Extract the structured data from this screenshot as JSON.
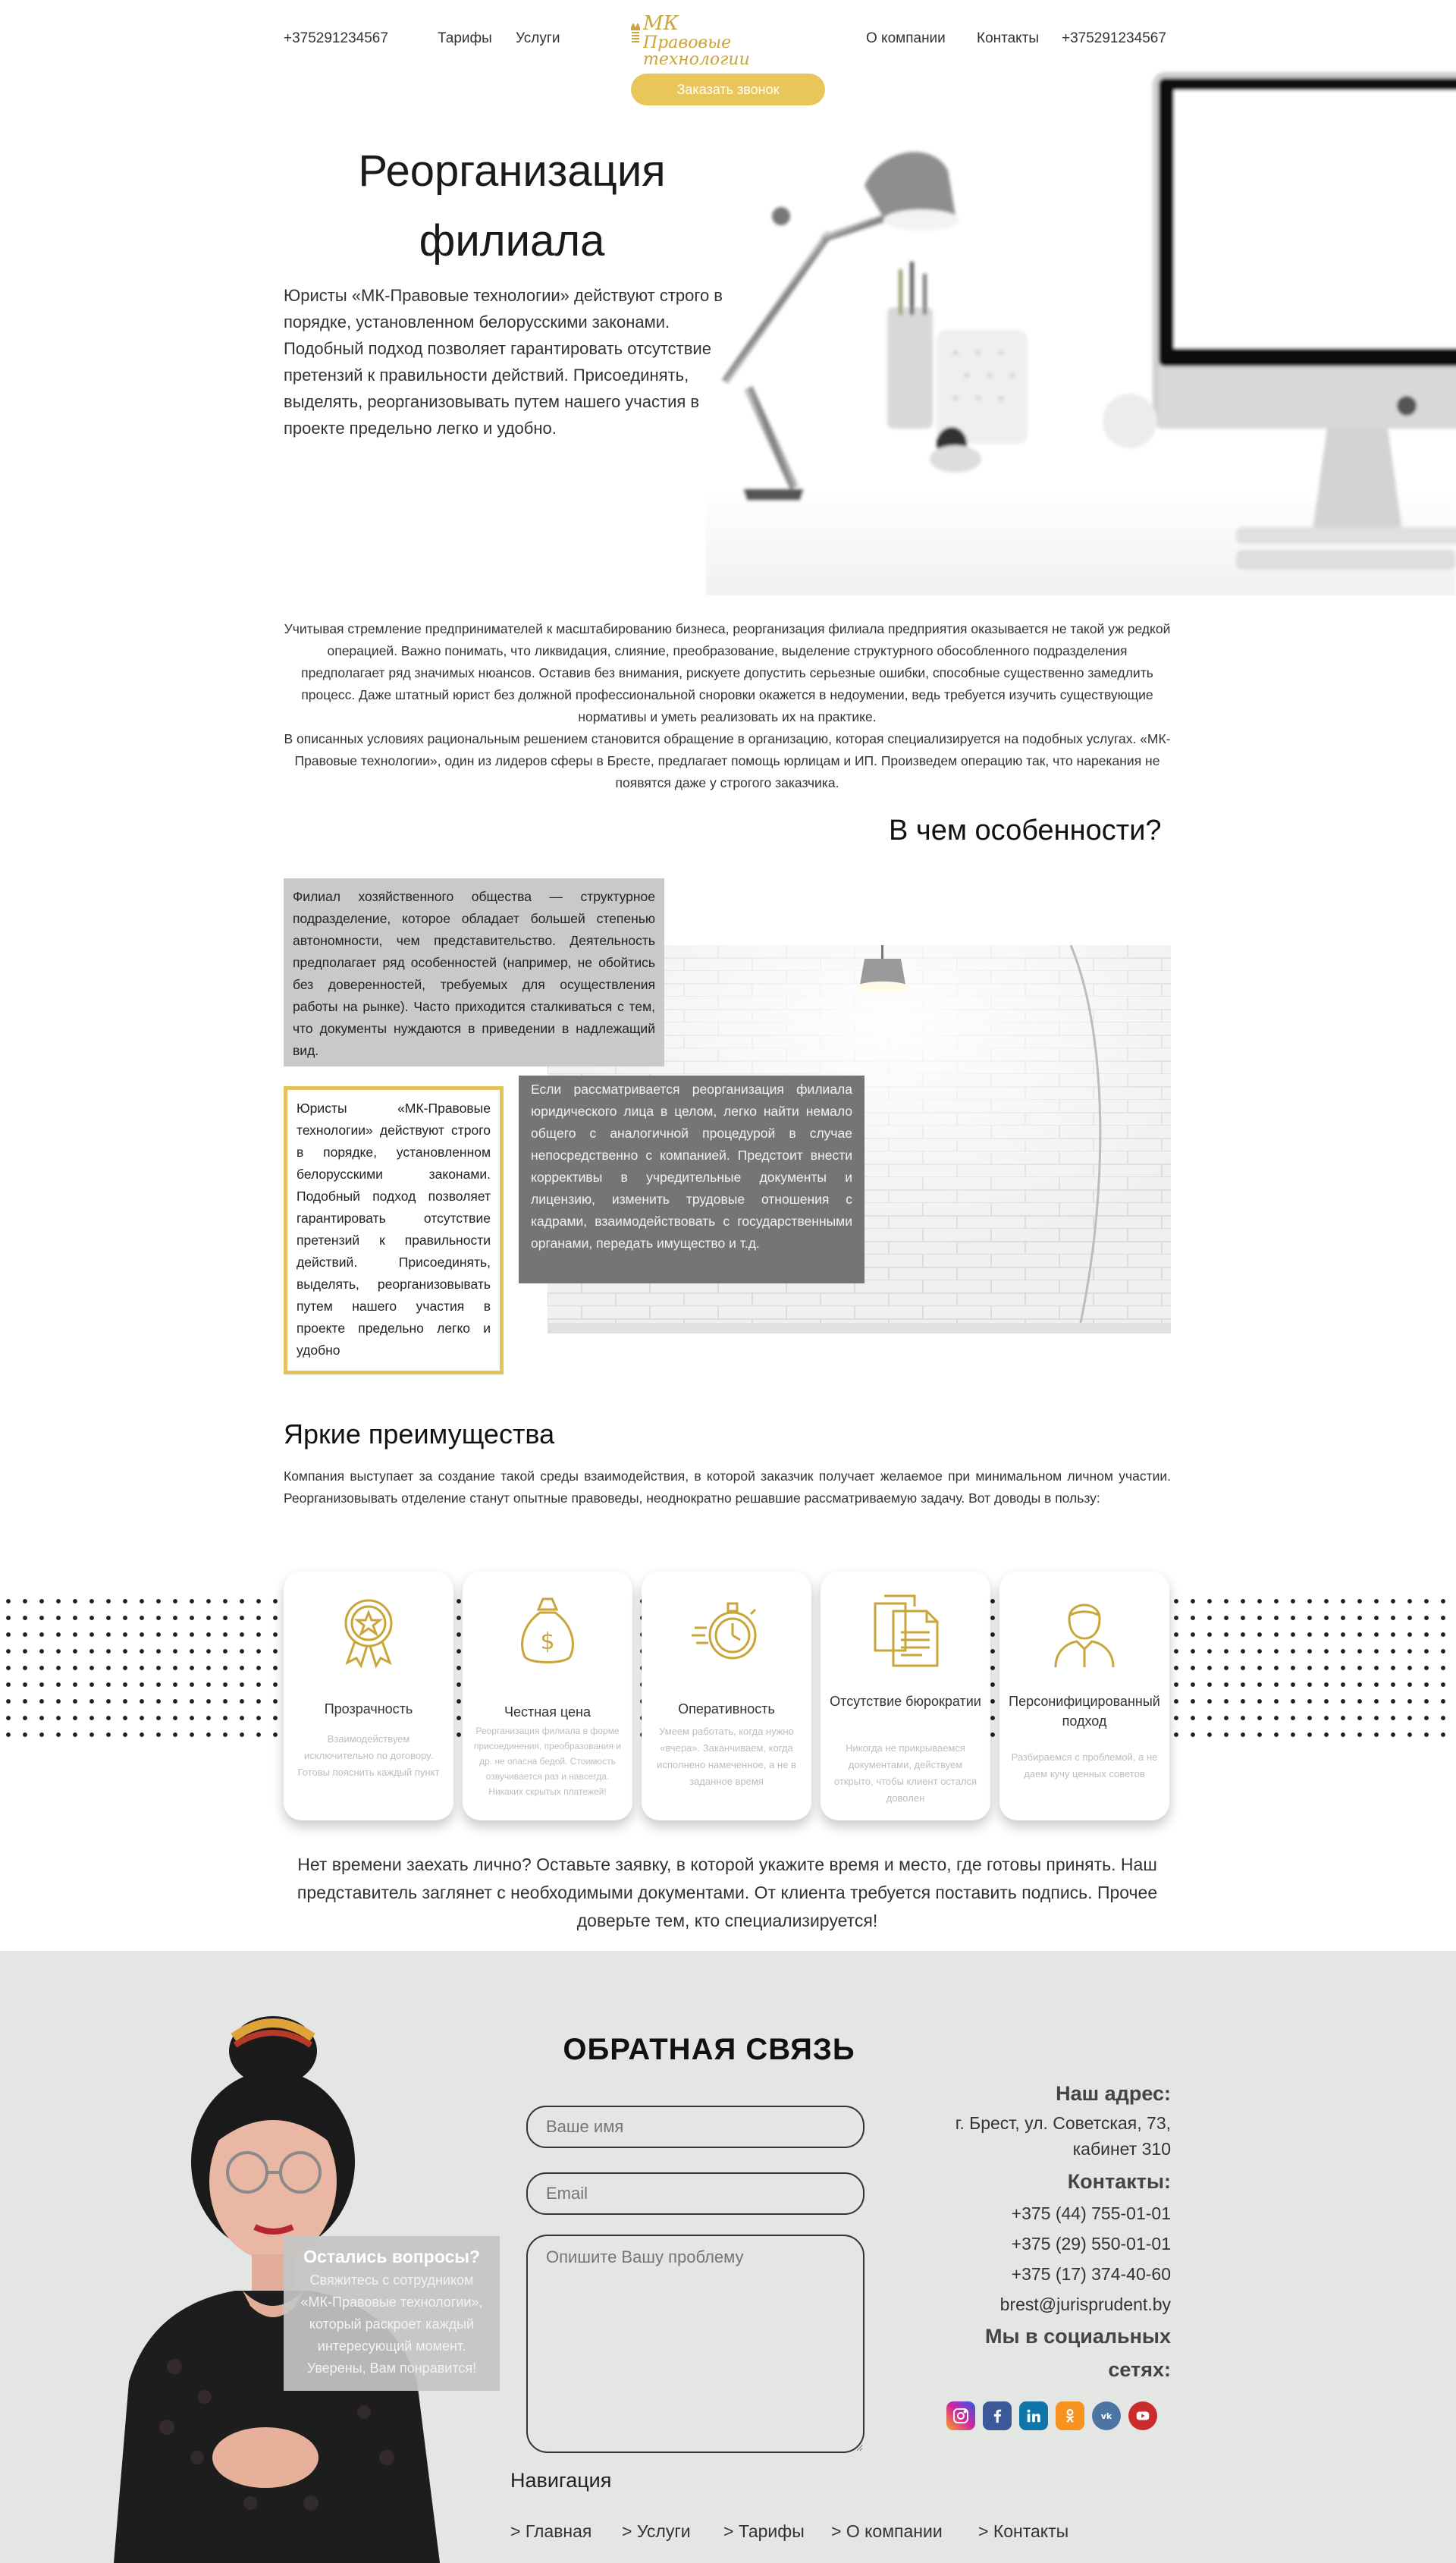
{
  "header": {
    "phone_left": "+375291234567",
    "nav_left": [
      "Тарифы",
      "Услуги"
    ],
    "logo_mk": "МК",
    "logo_sub": "Правовые технологии",
    "nav_right": [
      "О компании",
      "Контакты"
    ],
    "phone_right": "+375291234567",
    "call_button": "Заказать звонок"
  },
  "hero": {
    "title_line1": "Реорганизация",
    "title_line2": "филиала",
    "text": "Юристы «МК-Правовые технологии» действуют строго в порядке, установленном белорусскими законами. Подобный подход позволяет гарантировать отсутствие претензий к правильности действий. Присоединять, выделять, реорганизовывать путем нашего участия в проекте предельно легко и удобно."
  },
  "intro": {
    "p1": "Учитывая стремление предпринимателей к масштабированию бизнеса, реорганизация филиала предприятия оказывается не такой уж редкой операцией. Важно понимать, что ликвидация, слияние, преобразование, выделение структурного обособленного подразделения предполагает ряд значимых нюансов. Оставив без внимания, рискуете допустить серьезные ошибки, способные существенно замедлить процесс. Даже штатный юрист без должной профессиональной сноровки окажется в недоумении, ведь требуется изучить существующие нормативы и уметь реализовать их на практике.",
    "p2": "В описанных условиях рациональным решением становится обращение в организацию, которая специализируется на подобных услугах. «МК-Правовые технологии», один из лидеров сферы в Бресте, предлагает помощь юрлицам и ИП. Произведем операцию так, что нарекания не появятся даже у строгого заказчика."
  },
  "features": {
    "title": "В чем особенности?",
    "box1": "Филиал хозяйственного общества — структурное подразделение, которое обладает большей степенью автономности, чем представительство. Деятельность предполагает ряд особенностей (например, не обойтись без доверенностей, требуемых для осуществления работы на рынке). Часто приходится сталкиваться с тем, что документы нуждаются в приведении в надлежащий вид.",
    "box2": "Юристы «МК-Правовые технологии» действуют строго в порядке, установленном белорусскими законами. Подобный подход позволяет гарантировать отсутствие претензий к правильности действий. Присоединять, выделять, реорганизовывать путем нашего участия в проекте предельно легко и удобно",
    "box3": "Если рассматривается реорганизация филиала юридического лица в целом, легко найти немало общего с аналогичной процедурой в случае непосредственно с компанией. Предстоит внести коррективы в учредительные документы и лицензию, изменить трудовые отношения с кадрами, взаимодействовать с государственными органами, передать имущество и т.д."
  },
  "advantages": {
    "title": "Яркие преимущества",
    "text": "Компания выступает за создание такой среды взаимодействия, в которой заказчик получает желаемое при минимальном личном участии. Реорганизовывать отделение станут опытные правоведы, неоднократно решавшие рассматриваемую задачу. Вот доводы в пользу:",
    "cards": [
      {
        "icon": "award-badge-icon",
        "title": "Прозрачность",
        "desc": "Взаимодействуем исключительно по договору. Готовы пояснить каждый пункт"
      },
      {
        "icon": "money-bag-icon",
        "title": "Честная цена",
        "desc": "Реорганизация филиала в форме присоединения, преобразования и др. не опасна бедой. Стоимость озвучивается раз и навсегда. Никаких скрытых платежей!"
      },
      {
        "icon": "stopwatch-icon",
        "title": "Оперативность",
        "desc": "Умеем работать, когда нужно «вчера». Заканчиваем, когда исполнено намеченное, а не в заданное время"
      },
      {
        "icon": "documents-icon",
        "title": "Отсутствие бюрократии",
        "desc": "Никогда не прикрываемся документами, действуем открыто, чтобы клиент остался доволен"
      },
      {
        "icon": "person-icon",
        "title": "Персонифицированный подход",
        "desc": "Разбираемся с проблемой, а не даем кучу ценных советов"
      }
    ]
  },
  "cta": {
    "text": "Нет времени заехать лично? Оставьте заявку, в которой укажите время и место, где готовы принять. Наш представитель заглянет с необходимыми документами. От клиента требуется поставить подпись. Прочее доверьте тем, кто специализируется!"
  },
  "feedback": {
    "title": "ОБРАТНАЯ СВЯЗЬ",
    "name_placeholder": "Ваше имя",
    "email_placeholder": "Email",
    "problem_placeholder": "Опишите Вашу проблему",
    "question_title": "Остались вопросы?",
    "question_text": "Свяжитесь с сотрудником «МК-Правовые технологии», который раскроет каждый интересующий момент. Уверены, Вам понравится!"
  },
  "contacts": {
    "address_title": "Наш адрес:",
    "address_line1": "г. Брест, ул. Советская, 73,",
    "address_line2": "кабинет 310",
    "contacts_title": "Контакты:",
    "phones": [
      "+375 (44) 755-01-01",
      "+375 (29) 550-01-01",
      "+375 (17) 374-40-60"
    ],
    "email": "brest@jurisprudent.by",
    "social_title_line1": "Мы в социальных",
    "social_title_line2": "сетях:",
    "social_icons": [
      "instagram-icon",
      "facebook-icon",
      "linkedin-icon",
      "odnoklassniki-icon",
      "vk-icon",
      "youtube-icon"
    ]
  },
  "footer_nav": {
    "title": "Навигация",
    "links": [
      "> Главная",
      "> Услуги",
      "> Тарифы",
      "> О компании",
      "> Контакты"
    ]
  },
  "colors": {
    "accent": "#e9c659",
    "gold": "#c9a53a",
    "footer_bg": "#e3e6e3"
  }
}
